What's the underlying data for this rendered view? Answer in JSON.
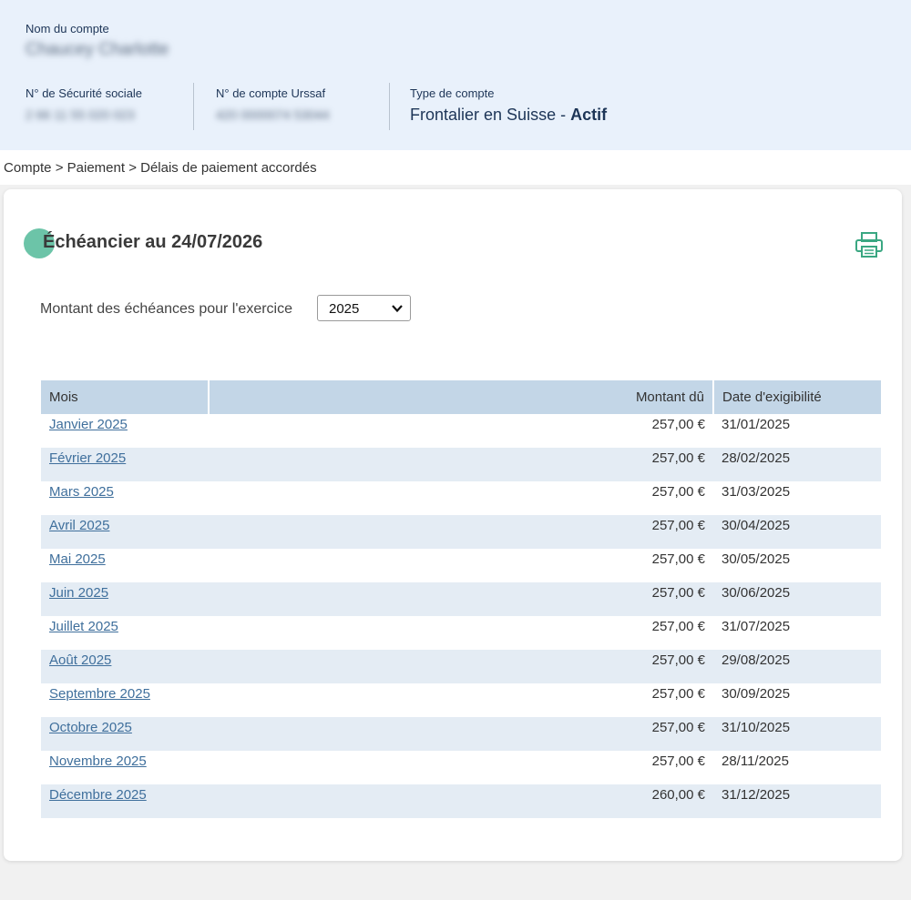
{
  "account": {
    "name_label": "Nom du compte",
    "name_value": "Chaucey Charlotte",
    "ssn_label": "N° de Sécurité sociale",
    "ssn_value": "2 66 11 55 020 023",
    "urssaf_label": "N° de compte Urssaf",
    "urssaf_value": "420 0000074 53044",
    "type_label": "Type de compte",
    "type_value": "Frontalier en Suisse - ",
    "type_status": "Actif"
  },
  "breadcrumb": {
    "items": [
      "Compte",
      "Paiement",
      "Délais de paiement accordés"
    ],
    "separator": ">"
  },
  "schedule": {
    "title": "Échéancier au 24/07/2026",
    "print_icon": "printer-icon",
    "exercise_label": "Montant des échéances pour l'exercice",
    "selected_year": "2025",
    "columns": {
      "month": "Mois",
      "amount": "Montant dû",
      "due_date": "Date d'exigibilité"
    },
    "rows": [
      {
        "month": "Janvier 2025",
        "amount": "257,00 €",
        "due_date": "31/01/2025"
      },
      {
        "month": "Février 2025",
        "amount": "257,00 €",
        "due_date": "28/02/2025"
      },
      {
        "month": "Mars 2025",
        "amount": "257,00 €",
        "due_date": "31/03/2025"
      },
      {
        "month": "Avril 2025",
        "amount": "257,00 €",
        "due_date": "30/04/2025"
      },
      {
        "month": "Mai 2025",
        "amount": "257,00 €",
        "due_date": "30/05/2025"
      },
      {
        "month": "Juin 2025",
        "amount": "257,00 €",
        "due_date": "30/06/2025"
      },
      {
        "month": "Juillet 2025",
        "amount": "257,00 €",
        "due_date": "31/07/2025"
      },
      {
        "month": "Août 2025",
        "amount": "257,00 €",
        "due_date": "29/08/2025"
      },
      {
        "month": "Septembre 2025",
        "amount": "257,00 €",
        "due_date": "30/09/2025"
      },
      {
        "month": "Octobre 2025",
        "amount": "257,00 €",
        "due_date": "31/10/2025"
      },
      {
        "month": "Novembre 2025",
        "amount": "257,00 €",
        "due_date": "28/11/2025"
      },
      {
        "month": "Décembre 2025",
        "amount": "260,00 €",
        "due_date": "31/12/2025"
      }
    ]
  },
  "colors": {
    "header_bg": "#e9f1fb",
    "accent_green": "#6cc4a8",
    "table_header_bg": "#c3d6e7",
    "row_alt_bg": "#e4ecf4",
    "link": "#3f6f9c"
  }
}
